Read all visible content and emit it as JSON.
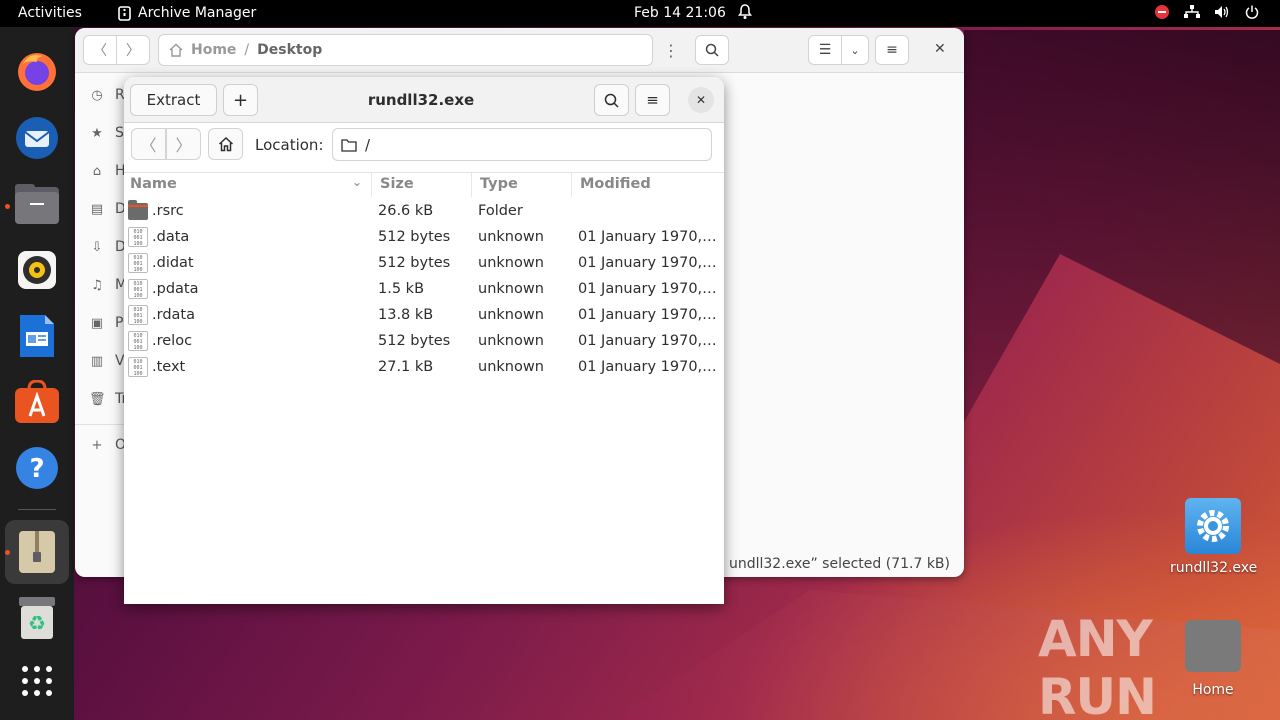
{
  "topbar": {
    "activities": "Activities",
    "app_name": "Archive Manager",
    "clock": "Feb 14  21:06"
  },
  "dock": {
    "items": [
      "Firefox",
      "Thunderbird",
      "Files",
      "Rhythmbox",
      "LibreOffice Writer",
      "Ubuntu Software",
      "Help",
      "Archive Manager",
      "Trash",
      "Show Applications"
    ]
  },
  "files_window": {
    "path": [
      "Home",
      "Desktop"
    ],
    "sidebar": [
      "Re",
      "St",
      "H",
      "D",
      "D",
      "M",
      "Pi",
      "Vi",
      "Tr",
      "O"
    ],
    "status": "undll32.exe” selected (71.7 kB)"
  },
  "archive_window": {
    "extract_label": "Extract",
    "add_label": "+",
    "title": "rundll32.exe",
    "location_label": "Location:",
    "location_value": "/",
    "columns": {
      "name": "Name",
      "size": "Size",
      "type": "Type",
      "modified": "Modified"
    },
    "rows": [
      {
        "name": ".rsrc",
        "size": "26.6 kB",
        "type": "Folder",
        "modified": "",
        "icon": "folder-icon"
      },
      {
        "name": ".data",
        "size": "512 bytes",
        "type": "unknown",
        "modified": "01 January 1970,…",
        "icon": "binary-file-icon"
      },
      {
        "name": ".didat",
        "size": "512 bytes",
        "type": "unknown",
        "modified": "01 January 1970,…",
        "icon": "binary-file-icon"
      },
      {
        "name": ".pdata",
        "size": "1.5 kB",
        "type": "unknown",
        "modified": "01 January 1970,…",
        "icon": "binary-file-icon"
      },
      {
        "name": ".rdata",
        "size": "13.8 kB",
        "type": "unknown",
        "modified": "01 January 1970,…",
        "icon": "binary-file-icon"
      },
      {
        "name": ".reloc",
        "size": "512 bytes",
        "type": "unknown",
        "modified": "01 January 1970,…",
        "icon": "binary-file-icon"
      },
      {
        "name": ".text",
        "size": "27.1 kB",
        "type": "unknown",
        "modified": "01 January 1970,…",
        "icon": "binary-file-icon"
      }
    ]
  },
  "desktop": {
    "icons": [
      {
        "label": "rundll32.exe"
      },
      {
        "label": "Home"
      }
    ],
    "watermark": "ANY RUN"
  },
  "colors": {
    "accent": "#e95420",
    "topbar": "#000000",
    "dock": "#1e1e1e"
  }
}
